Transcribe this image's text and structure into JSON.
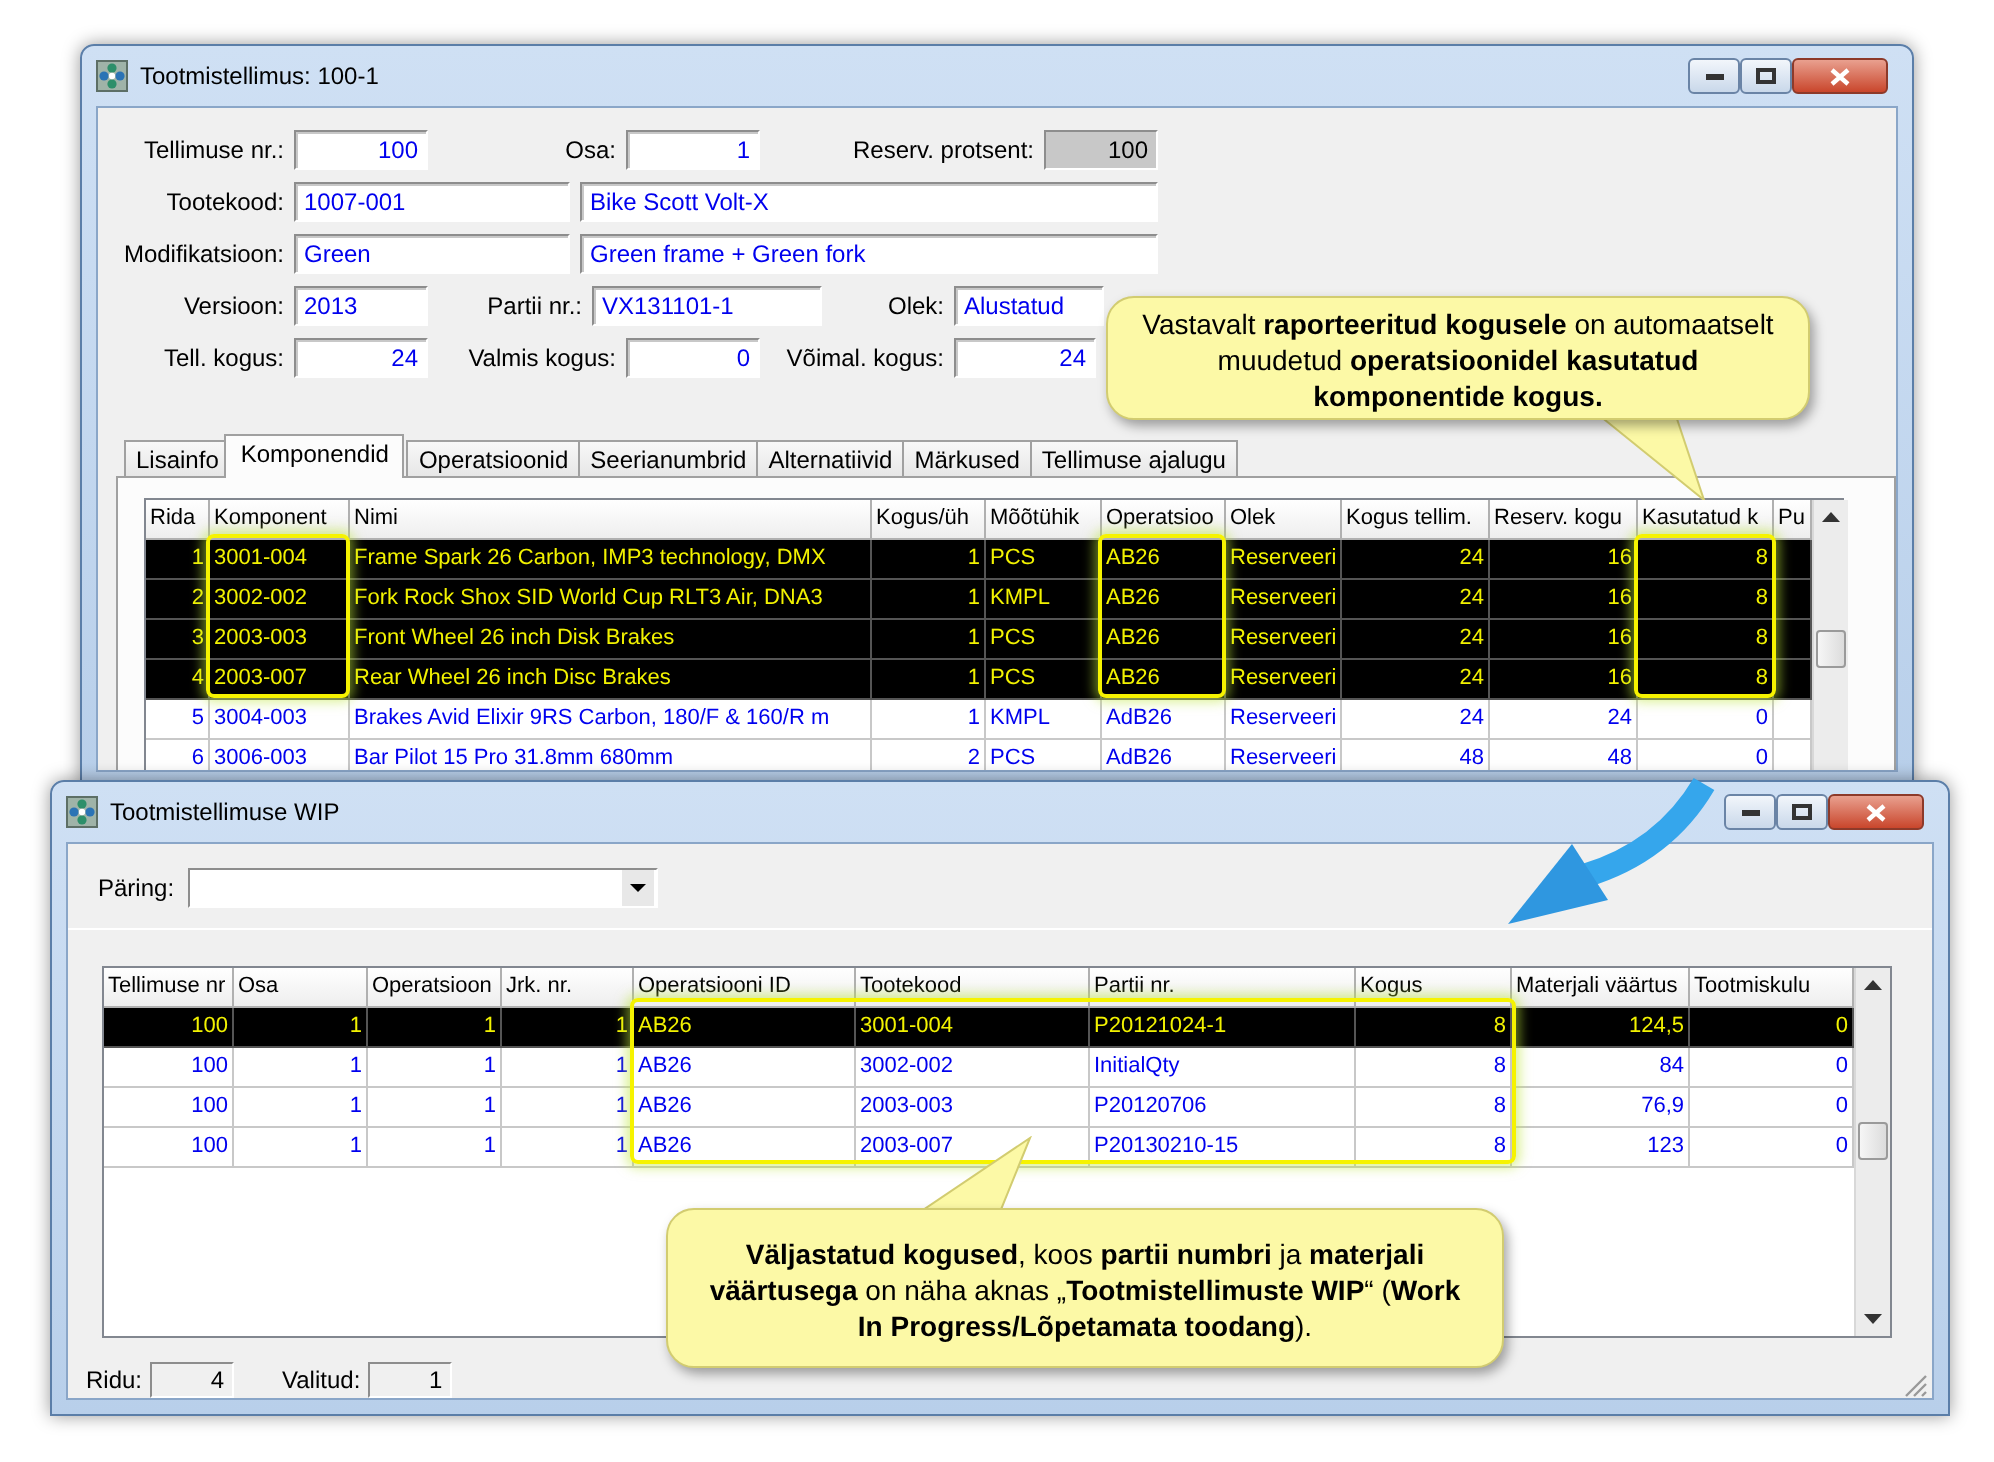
{
  "order_window": {
    "title": "Tootmistellimus: 100-1",
    "form_rows": [
      {
        "items": [
          {
            "kind": "label",
            "text": "Tellimuse nr.:"
          },
          {
            "kind": "number",
            "value": "100",
            "disabled": false
          },
          {
            "kind": "label",
            "text": "Osa:"
          },
          {
            "kind": "number",
            "value": "1",
            "disabled": false
          },
          {
            "kind": "label",
            "text": "Reserv. protsent:"
          },
          {
            "kind": "number",
            "value": "100",
            "disabled": true
          }
        ]
      },
      {
        "items": [
          {
            "kind": "label",
            "text": "Tootekood:"
          },
          {
            "kind": "text",
            "value": "1007-001",
            "disabled": false
          },
          {
            "kind": "text",
            "value": "Bike Scott Volt-X",
            "disabled": false
          }
        ]
      },
      {
        "items": [
          {
            "kind": "label",
            "text": "Modifikatsioon:"
          },
          {
            "kind": "text",
            "value": "Green",
            "disabled": false
          },
          {
            "kind": "text",
            "value": "Green frame + Green fork",
            "disabled": false
          }
        ]
      },
      {
        "items": [
          {
            "kind": "label",
            "text": "Versioon:"
          },
          {
            "kind": "text",
            "value": "2013",
            "disabled": false
          },
          {
            "kind": "label",
            "text": "Partii nr.:"
          },
          {
            "kind": "text",
            "value": "VX131101-1",
            "disabled": false
          },
          {
            "kind": "label",
            "text": "Olek:"
          },
          {
            "kind": "text",
            "value": "Alustatud",
            "disabled": false
          }
        ]
      },
      {
        "items": [
          {
            "kind": "label",
            "text": "Tell. kogus:"
          },
          {
            "kind": "number",
            "value": "24",
            "disabled": false
          },
          {
            "kind": "label",
            "text": "Valmis kogus:"
          },
          {
            "kind": "number",
            "value": "0",
            "disabled": false
          },
          {
            "kind": "label",
            "text": "Võimal. kogus:"
          },
          {
            "kind": "number",
            "value": "24",
            "disabled": false
          }
        ]
      }
    ],
    "tabs": [
      {
        "label": "Lisainfo",
        "selected": false
      },
      {
        "label": "Komponendid",
        "selected": true
      },
      {
        "label": "Operatsioonid",
        "selected": false
      },
      {
        "label": "Seerianumbrid",
        "selected": false
      },
      {
        "label": "Alternatiivid",
        "selected": false
      },
      {
        "label": "Märkused",
        "selected": false
      },
      {
        "label": "Tellimuse ajalugu",
        "selected": false
      }
    ],
    "table": {
      "columns": [
        "Rida",
        "Komponent",
        "Nimi",
        "Kogus/üh",
        "Mõõtühik",
        "Operatsioo",
        "Olek",
        "Kogus tellim.",
        "Reserv. kogu",
        "Kasutatud k",
        "Pu"
      ],
      "rows": [
        {
          "selected": true,
          "cells": [
            "1",
            "3001-004",
            "Frame Spark 26 Carbon, IMP3 technology, DMX",
            "1",
            "PCS",
            "AB26",
            "Reserveeri",
            "24",
            "16",
            "8"
          ]
        },
        {
          "selected": true,
          "cells": [
            "2",
            "3002-002",
            "Fork Rock Shox SID World Cup RLT3 Air, DNA3",
            "1",
            "KMPL",
            "AB26",
            "Reserveeri",
            "24",
            "16",
            "8"
          ]
        },
        {
          "selected": true,
          "cells": [
            "3",
            "2003-003",
            "Front Wheel 26 inch Disk Brakes",
            "1",
            "PCS",
            "AB26",
            "Reserveeri",
            "24",
            "16",
            "8"
          ]
        },
        {
          "selected": true,
          "cells": [
            "4",
            "2003-007",
            "Rear Wheel 26 inch Disc Brakes",
            "1",
            "PCS",
            "AB26",
            "Reserveeri",
            "24",
            "16",
            "8"
          ]
        },
        {
          "selected": false,
          "cells": [
            "5",
            "3004-003",
            "Brakes Avid Elixir 9RS Carbon, 180/F & 160/R m",
            "1",
            "KMPL",
            "AdB26",
            "Reserveeri",
            "24",
            "24",
            "0"
          ]
        },
        {
          "selected": false,
          "cells": [
            "6",
            "3006-003",
            "Bar Pilot 15 Pro 31.8mm 680mm",
            "2",
            "PCS",
            "AdB26",
            "Reserveeri",
            "48",
            "48",
            "0"
          ]
        }
      ]
    }
  },
  "wip_window": {
    "title": "Tootmistellimuse WIP",
    "query": {
      "label": "Päring:"
    },
    "table": {
      "columns": [
        "Tellimuse nr",
        "Osa",
        "Operatsioon",
        "Jrk. nr.",
        "Operatsiooni ID",
        "Tootekood",
        "Partii nr.",
        "Kogus",
        "Materjali väärtus",
        "Tootmiskulu"
      ],
      "rows": [
        {
          "selected": true,
          "cells": [
            "100",
            "1",
            "1",
            "1",
            "AB26",
            "3001-004",
            "P20121024-1",
            "8",
            "124,5",
            "0"
          ]
        },
        {
          "selected": false,
          "cells": [
            "100",
            "1",
            "1",
            "1",
            "AB26",
            "3002-002",
            "InitialQty",
            "8",
            "84",
            "0"
          ]
        },
        {
          "selected": false,
          "cells": [
            "100",
            "1",
            "1",
            "1",
            "AB26",
            "2003-003",
            "P20120706",
            "8",
            "76,9",
            "0"
          ]
        },
        {
          "selected": false,
          "cells": [
            "100",
            "1",
            "1",
            "1",
            "AB26",
            "2003-007",
            "P20130210-15",
            "8",
            "123",
            "0"
          ]
        }
      ]
    },
    "status_bar": [
      {
        "label": "Ridu:",
        "value": "4"
      },
      {
        "label": "Valitud:",
        "value": "1"
      }
    ]
  },
  "callouts": [
    {
      "text": "Vastavalt **raporteeritud kogusele** on automaatselt muudetud **operatsioonidel kasutatud komponentide kogus.**"
    },
    {
      "text": "**Väljastatud kogused**, koos **partii numbri** ja **materjali väärtusega** on näha aknas „**Tootmistellimuste WIP**“ (**Work In Progress/Lõpetamata toodang**)."
    }
  ]
}
